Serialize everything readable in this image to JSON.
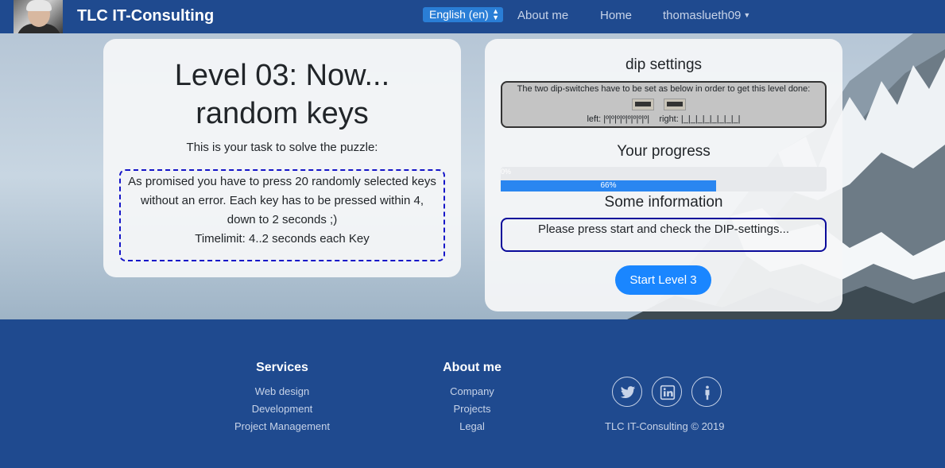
{
  "header": {
    "brand": "TLC IT-Consulting",
    "language": "English (en)",
    "nav": [
      "About me",
      "Home"
    ],
    "user": "thomaslueth09"
  },
  "level": {
    "title_line1": "Level 03: Now...",
    "title_line2": "random keys",
    "task_label": "This is your task to solve the puzzle:",
    "task_lines": [
      "As promised you have to press 20 randomly selected keys",
      "without an error. Each key has to be pressed within 4,",
      "down to 2 seconds ;)",
      "Timelimit: 4..2 seconds each Key"
    ]
  },
  "dip": {
    "title": "dip settings",
    "instruction": "The two dip-switches have to be set as below in order to get this level done:",
    "left_label": "left:",
    "left_value": "|º|º|º|º|º|º|º|º|",
    "right_label": "right:",
    "right_value": "|_|_|_|_|_|_|_|_|"
  },
  "progress": {
    "title": "Your progress",
    "small_label": "0%",
    "label": "66%",
    "value": 0.66
  },
  "info": {
    "title": "Some information",
    "message": "Please press start and check the DIP-settings..."
  },
  "start_label": "Start Level 3",
  "footer": {
    "services": {
      "heading": "Services",
      "links": [
        "Web design",
        "Development",
        "Project Management"
      ]
    },
    "about": {
      "heading": "About me",
      "links": [
        "Company",
        "Projects",
        "Legal"
      ]
    },
    "social": [
      "twitter-icon",
      "linkedin-icon",
      "person-icon"
    ],
    "copyright": "TLC IT-Consulting © 2019"
  },
  "colors": {
    "navbar": "#1f4a8f",
    "accent": "#1a86ff",
    "task_border": "#1515c8",
    "info_border": "#0a0a9a"
  }
}
